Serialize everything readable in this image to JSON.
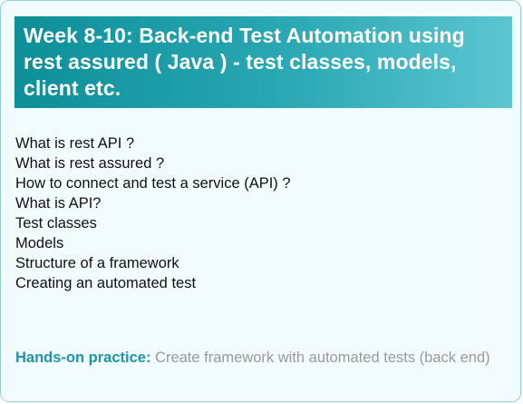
{
  "banner": {
    "title": "Week 8-10: Back-end Test Automation using rest assured ( Java ) - test classes, models, client etc."
  },
  "topics": [
    "What is rest API ?",
    "What is rest assured ?",
    "How to connect and test a service (API) ?",
    "What is API?",
    "Test classes",
    "Models",
    "Structure of a framework",
    "Creating an automated test"
  ],
  "practice": {
    "label": "Hands-on practice:",
    "text": "Create framework with automated tests (back end)"
  },
  "colors": {
    "banner_start": "#0d8f98",
    "banner_end": "#5cc6d2",
    "accent": "#1a98a6",
    "card_background": "#f2fbfd",
    "card_border": "#8fd3d8"
  }
}
